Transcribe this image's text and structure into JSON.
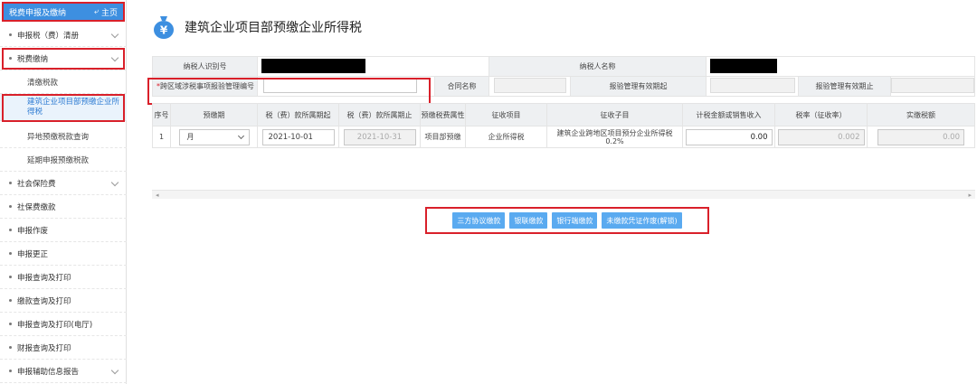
{
  "sidebar": {
    "header_title": "税费申报及缴纳",
    "home_label": "主页",
    "items": [
      {
        "label": "申报税（费）清册"
      },
      {
        "label": "税费缴纳"
      },
      {
        "label": "社会保险费"
      },
      {
        "label": "社保费缴款"
      },
      {
        "label": "申报作废"
      },
      {
        "label": "申报更正"
      },
      {
        "label": "申报查询及打印"
      },
      {
        "label": "缴款查询及打印"
      },
      {
        "label": "申报查询及打印(电厅)"
      },
      {
        "label": "财报查询及打印"
      },
      {
        "label": "申报辅助信息报告"
      }
    ],
    "sub_items": [
      {
        "label": "清缴税款"
      },
      {
        "label": "建筑企业项目部预缴企业所得税"
      },
      {
        "label": "异地预缴税款查询"
      },
      {
        "label": "延期申报预缴税款"
      }
    ]
  },
  "page": {
    "title": "建筑企业项目部预缴企业所得税",
    "title_icon_glyph": "¥"
  },
  "form": {
    "taxpayer_id_label": "纳税人识别号",
    "taxpayer_name_label": "纳税人名称",
    "cross_region_required_mark": "*",
    "cross_region_label": "跨区域涉税事项报验管理编号",
    "cross_region_value": "",
    "contract_name_label": "合同名称",
    "contract_name_value": "",
    "valid_from_label": "报验管理有效期起",
    "valid_to_label": "报验管理有效期止"
  },
  "grid": {
    "headers": [
      "序号",
      "预缴期",
      "税（费）款所属期起",
      "税（费）款所属期止",
      "预缴税费属性",
      "征收项目",
      "征收子目",
      "计税金额或销售收入",
      "税率（征收率）",
      "实缴税额"
    ],
    "rows": [
      {
        "index": "1",
        "period": "月",
        "start_date": "2021-10-01",
        "end_date": "2021-10-31",
        "attribute": "项目部预缴",
        "item": "企业所得税",
        "sub_item": "建筑企业跨地区项目预分企业所得税0.2%",
        "taxable_amount": "0.00",
        "rate": "0.002",
        "paid_tax": "0.00"
      }
    ]
  },
  "actions": {
    "buttons": [
      {
        "label": "三方协议缴款"
      },
      {
        "label": "银联缴款"
      },
      {
        "label": "银行端缴款"
      },
      {
        "label": "未缴款凭证作废(解锁)"
      }
    ]
  },
  "colors": {
    "accent": "#3d8fe0",
    "button": "#5aaaf0",
    "highlight_box": "#d9202a",
    "label_bg": "#eef0f2"
  }
}
